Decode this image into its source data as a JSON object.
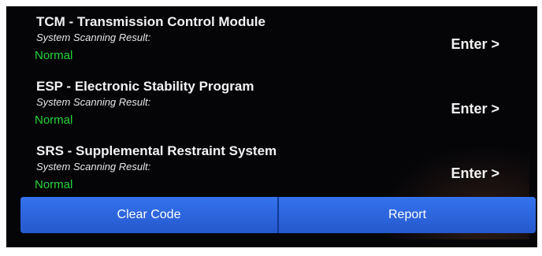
{
  "modules": [
    {
      "title": "TCM - Transmission Control Module",
      "result_label": "System Scanning Result:",
      "status": "Normal",
      "action": "Enter >"
    },
    {
      "title": "ESP - Electronic Stability Program",
      "result_label": "System Scanning Result:",
      "status": "Normal",
      "action": "Enter >"
    },
    {
      "title": "SRS - Supplemental Restraint System",
      "result_label": "System Scanning Result:",
      "status": "Normal",
      "action": "Enter >"
    }
  ],
  "buttons": {
    "clear_code": "Clear Code",
    "report": "Report"
  },
  "colors": {
    "background": "#050508",
    "status_ok": "#27d43a",
    "button": "#2c66e0"
  }
}
